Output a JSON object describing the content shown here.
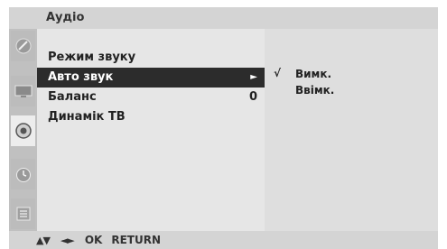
{
  "header": {
    "title": "Аудіо"
  },
  "sidebar": {
    "icons": [
      {
        "name": "satellite-dish-icon",
        "active": false
      },
      {
        "name": "picture-icon",
        "active": false
      },
      {
        "name": "speaker-icon",
        "active": true
      },
      {
        "name": "clock-icon",
        "active": false
      },
      {
        "name": "option-icon",
        "active": false
      }
    ]
  },
  "menu": {
    "items": [
      {
        "label": "Режим звуку",
        "value": "",
        "arrow": ""
      },
      {
        "label": "Авто звук",
        "value": "",
        "arrow": "►"
      },
      {
        "label": "Баланс",
        "value": "0",
        "arrow": ""
      },
      {
        "label": "Динамік ТВ",
        "value": "",
        "arrow": ""
      }
    ],
    "selected_index": 1
  },
  "submenu": {
    "options": [
      {
        "label": "Вимк.",
        "checked": true,
        "check_mark": "√"
      },
      {
        "label": "Ввімк.",
        "checked": false,
        "check_mark": ""
      }
    ]
  },
  "footer": {
    "hints": [
      {
        "icon": "up-down-arrows-icon",
        "glyph": "▲▼"
      },
      {
        "icon": "left-right-arrows-icon",
        "glyph": "◄►"
      },
      {
        "label": "OK"
      },
      {
        "label": "RETURN"
      }
    ]
  },
  "colors": {
    "selected_bg": "#2c2c2c",
    "menu_bg": "#e6e6e6",
    "submenu_bg": "#dedede",
    "icon_col_bg": "#c0c0c0",
    "bar_bg": "#d4d4d4"
  }
}
